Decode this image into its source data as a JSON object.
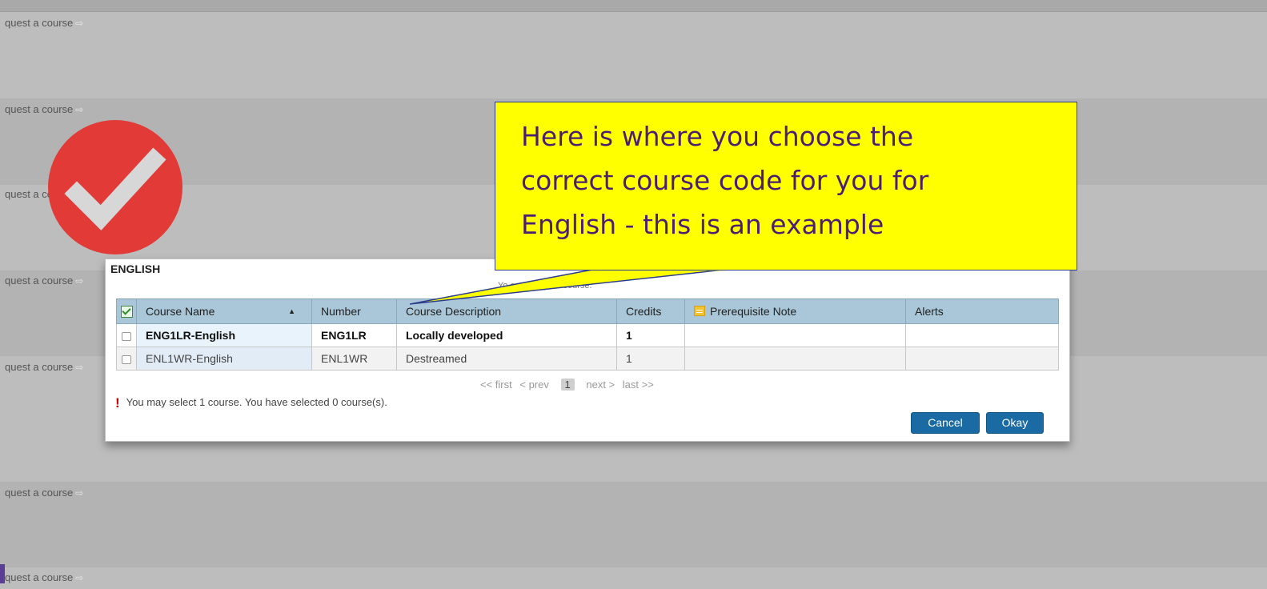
{
  "background_rows": {
    "request_label": "quest a course",
    "arrow_icon": "right-arrow-icon"
  },
  "dialog": {
    "title": "ENGLISH",
    "subtitle": "Yo          ect 1 English course.",
    "columns": {
      "course_name": "Course Name",
      "number": "Number",
      "course_description": "Course Description",
      "credits": "Credits",
      "prerequisite_note": "Prerequisite Note",
      "alerts": "Alerts"
    },
    "rows": [
      {
        "course_name": "ENG1LR-English",
        "number": "ENG1LR",
        "course_description": "Locally developed",
        "credits": "1",
        "prerequisite_note": "",
        "alerts": ""
      },
      {
        "course_name": "ENL1WR-English",
        "number": "ENL1WR",
        "course_description": "Destreamed",
        "credits": "1",
        "prerequisite_note": "",
        "alerts": ""
      }
    ],
    "pager": {
      "first": "<< first",
      "prev": "< prev",
      "page": "1",
      "next": "next >",
      "last": "last >>"
    },
    "warning": "You may select 1 course.  You have selected 0 course(s).",
    "buttons": {
      "cancel": "Cancel",
      "okay": "Okay"
    }
  },
  "callout": {
    "line1": "Here is where you choose the",
    "line2": "correct course code for you for",
    "line3": "English - this is an example"
  },
  "colors": {
    "callout_bg": "#ffff00",
    "callout_text": "#4b1f6f",
    "badge": "#e23a36",
    "button": "#1a6aa4",
    "header": "#a9c7d8"
  }
}
